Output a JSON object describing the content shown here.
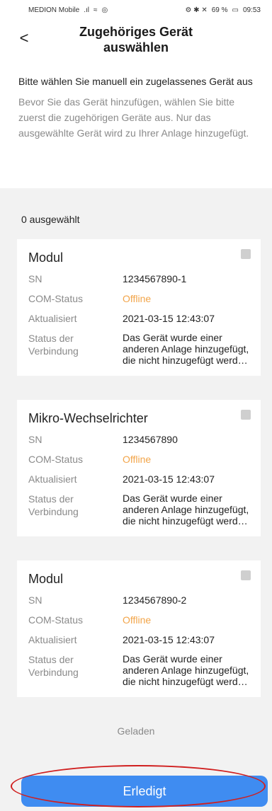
{
  "status_bar": {
    "carrier": "MEDION Mobile",
    "signal": ".ıl",
    "wifi": "≈",
    "vpn": "◎",
    "right_icons": "⚙ ✱ ✕",
    "battery_pct": "69 %",
    "time": "09:53"
  },
  "header": {
    "back_icon": "<",
    "title": "Zugehöriges Gerät auswählen"
  },
  "intro": {
    "main": "Bitte wählen Sie manuell ein zugelassenes Gerät aus",
    "desc": "Bevor Sie das Gerät hinzufügen, wählen Sie bitte zuerst die zugehörigen Geräte aus. Nur das ausgewählte Gerät wird zu Ihrer Anlage hinzugefügt."
  },
  "selection": {
    "count_label": "0 ausgewählt"
  },
  "devices": [
    {
      "name": "Modul",
      "sn_label": "SN",
      "sn": "1234567890-1",
      "com_label": "COM-Status",
      "com_status": "Offline",
      "updated_label": "Aktualisiert",
      "updated": "2021-03-15 12:43:07",
      "conn_label": "Status der Verbindung",
      "conn_status": "Das Gerät wurde einer anderen Anlage hinzugefügt, die nicht hinzugefügt werd…"
    },
    {
      "name": "Mikro-Wechselrichter",
      "sn_label": "SN",
      "sn": "1234567890",
      "com_label": "COM-Status",
      "com_status": "Offline",
      "updated_label": "Aktualisiert",
      "updated": "2021-03-15 12:43:07",
      "conn_label": "Status der Verbindung",
      "conn_status": "Das Gerät wurde einer anderen Anlage hinzugefügt, die nicht hinzugefügt werd…"
    },
    {
      "name": "Modul",
      "sn_label": "SN",
      "sn": "1234567890-2",
      "com_label": "COM-Status",
      "com_status": "Offline",
      "updated_label": "Aktualisiert",
      "updated": "2021-03-15 12:43:07",
      "conn_label": "Status der Verbindung",
      "conn_status": "Das Gerät wurde einer anderen Anlage hinzugefügt, die nicht hinzugefügt werd…"
    }
  ],
  "footer": {
    "loaded": "Geladen",
    "done_button": "Erledigt"
  }
}
